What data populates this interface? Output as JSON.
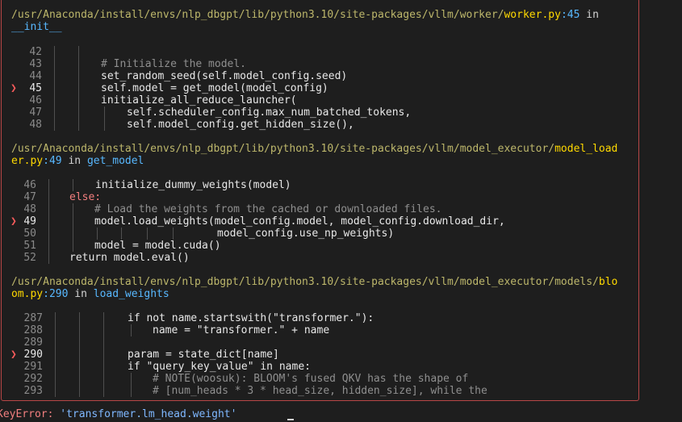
{
  "frames": [
    {
      "path_dir": "/usr/Anaconda/install/envs/nlp_dbgpt/lib/python3.10/site-packages/vllm/worker/",
      "path_file": "worker.py",
      "path_lineno": ":45",
      "path_in": " in",
      "func": "__init__",
      "lines": [
        {
          "n": "42",
          "active": false
        },
        {
          "n": "43",
          "active": false
        },
        {
          "n": "44",
          "active": false
        },
        {
          "n": "45",
          "active": true
        },
        {
          "n": "46",
          "active": false
        },
        {
          "n": "47",
          "active": false
        },
        {
          "n": "48",
          "active": false
        }
      ],
      "code": [
        "",
        "# Initialize the model.",
        "set_random_seed(self.model_config.seed)",
        "self.model = get_model(model_config)",
        "initialize_all_reduce_launcher(",
        "self.scheduler_config.max_num_batched_tokens,",
        "self.model_config.get_hidden_size(),"
      ]
    },
    {
      "path_dir": "/usr/Anaconda/install/envs/nlp_dbgpt/lib/python3.10/site-packages/vllm/model_executor/",
      "path_file_a": "model_load",
      "path_file_b": "er.py",
      "path_lineno": ":49",
      "path_in": " in ",
      "func": "get_model",
      "lines": [
        {
          "n": "46",
          "active": false
        },
        {
          "n": "47",
          "active": false
        },
        {
          "n": "48",
          "active": false
        },
        {
          "n": "49",
          "active": true
        },
        {
          "n": "50",
          "active": false
        },
        {
          "n": "51",
          "active": false
        },
        {
          "n": "52",
          "active": false
        }
      ],
      "code": [
        "initialize_dummy_weights(model)",
        "else:",
        "# Load the weights from the cached or downloaded files.",
        "model.load_weights(model_config.model, model_config.download_dir,",
        "model_config.use_np_weights)",
        "model = model.cuda()",
        "return model.eval()"
      ]
    },
    {
      "path_dir": "/usr/Anaconda/install/envs/nlp_dbgpt/lib/python3.10/site-packages/vllm/model_executor/models/",
      "path_file_a": "blo",
      "path_file_b": "om.py",
      "path_lineno": ":290",
      "path_in": " in ",
      "func": "load_weights",
      "lines": [
        {
          "n": "287",
          "active": false
        },
        {
          "n": "288",
          "active": false
        },
        {
          "n": "289",
          "active": false
        },
        {
          "n": "290",
          "active": true
        },
        {
          "n": "291",
          "active": false
        },
        {
          "n": "292",
          "active": false
        },
        {
          "n": "293",
          "active": false
        }
      ],
      "code": [
        "if not name.startswith(\"transformer.\"):",
        "name = \"transformer.\" + name",
        "",
        "param = state_dict[name]",
        "if \"query_key_value\" in name:",
        "# NOTE(woosuk): BLOOM's fused QKV has the shape of",
        "# [num_heads * 3 * head_size, hidden_size], while the"
      ]
    }
  ],
  "error": {
    "type": "KeyError:",
    "message": " 'transformer.lm_head.weight'"
  },
  "marker_glyph": "❯"
}
